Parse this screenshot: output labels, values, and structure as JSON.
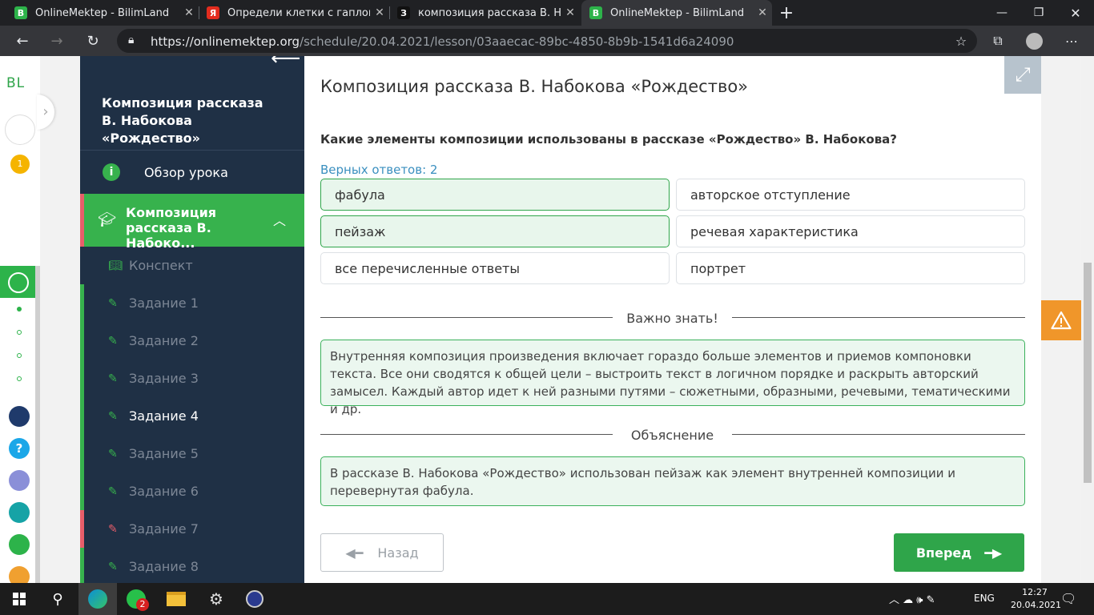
{
  "browser": {
    "tabs": [
      {
        "title": "OnlineMektep - BilimLand",
        "fav_color": "#2db34a",
        "fav_glyph": "B"
      },
      {
        "title": "Определи клетки с гаплоидным",
        "fav_color": "#e32c1e",
        "fav_glyph": "Я"
      },
      {
        "title": "композиция рассказа В. Набоко",
        "fav_color": "#111111",
        "fav_glyph": "З"
      },
      {
        "title": "OnlineMektep - BilimLand",
        "fav_color": "#2db34a",
        "fav_glyph": "B"
      }
    ],
    "new_tab": "+",
    "url_main": "https://onlinemektep.org",
    "url_rest": "/schedule/20.04.2021/lesson/03aaecac-89bc-4850-8b9b-1541d6a24090"
  },
  "leftbar": {
    "logo": "BL",
    "badge": "1"
  },
  "sidebar": {
    "lesson_title": "Композиция рассказа В. Набокова «Рождество»",
    "overview_label": "Обзор урока",
    "section_label": "Композиция рассказа В. Набоко...",
    "items": [
      {
        "label": "Конспект",
        "icon": "book-icon",
        "status": ""
      },
      {
        "label": "Задание 1",
        "icon": "edit-icon",
        "status": "done"
      },
      {
        "label": "Задание 2",
        "icon": "edit-icon",
        "status": "done"
      },
      {
        "label": "Задание 3",
        "icon": "edit-icon",
        "status": "done"
      },
      {
        "label": "Задание 4",
        "icon": "edit-icon",
        "status": "current"
      },
      {
        "label": "Задание 5",
        "icon": "edit-icon",
        "status": "done"
      },
      {
        "label": "Задание 6",
        "icon": "edit-icon",
        "status": "done"
      },
      {
        "label": "Задание 7",
        "icon": "edit-icon",
        "status": "wrong"
      },
      {
        "label": "Задание 8",
        "icon": "edit-icon",
        "status": "done"
      }
    ]
  },
  "main": {
    "title": "Композиция рассказа В. Набокова «Рождество»",
    "question": "Какие элементы композиции использованы в рассказе «Рождество» В. Набокова?",
    "correct_count": "Верных ответов: 2",
    "options": [
      {
        "label": "фабула",
        "selected": true
      },
      {
        "label": "авторское отступление",
        "selected": false
      },
      {
        "label": "пейзаж",
        "selected": true
      },
      {
        "label": "речевая характеристика",
        "selected": false
      },
      {
        "label": "все перечисленные ответы",
        "selected": false
      },
      {
        "label": "портрет",
        "selected": false
      }
    ],
    "important_heading": "Важно знать!",
    "important_text": "Внутренняя композиция произведения включает гораздо больше элементов и приемов компоновки текста. Все они сводятся к общей цели – выстроить текст в логичном порядке и раскрыть авторский замысел. Каждый автор идет к ней разными путями – сюжетными, образными, речевыми, тематическими и др.",
    "explanation_heading": "Объяснение",
    "explanation_text": "В рассказе В. Набокова «Рождество» использован пейзаж как элемент внутренней композиции и перевернутая фабула.",
    "back_label": "Назад",
    "next_label": "Вперед"
  },
  "taskbar": {
    "whatsapp_badge": "2",
    "language": "ENG",
    "time": "12:27",
    "date": "20.04.2021"
  },
  "colors": {
    "accent_green": "#2fa54a",
    "sidebar_bg": "#1f3045",
    "warning_orange": "#f0962a"
  }
}
